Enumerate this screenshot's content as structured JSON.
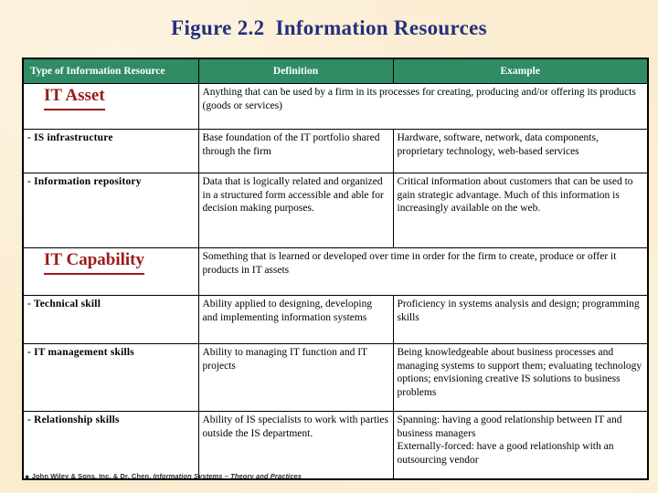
{
  "slide": {
    "title": "Figure 2.2  Information Resources",
    "background_color": "#faeccf",
    "title_color": "#262f7e",
    "header_color": "#2f8c65",
    "category_color": "#9b1b1b"
  },
  "table": {
    "headers": [
      "Type of Information Resource",
      "Definition",
      "Example"
    ],
    "rows": [
      {
        "kind": "category",
        "label": "IT Asset",
        "definition": "Anything that can be used by a firm in its processes for creating, producing and/or offering its products (goods or services)"
      },
      {
        "kind": "item",
        "label": "- IS infrastructure",
        "definition": "Base foundation of the IT portfolio shared through the firm",
        "example": "Hardware, software, network, data components, proprietary technology, web-based services"
      },
      {
        "kind": "item",
        "label": "- Information repository",
        "definition": "Data that is logically related and organized in a structured form accessible and able for decision making purposes.",
        "example": "Critical information about customers that can be used to gain strategic advantage.  Much of this information is increasingly available on the web."
      },
      {
        "kind": "category",
        "label": "IT Capability",
        "definition": "Something that is learned or developed over time in order for the firm to create, produce or offer it products in IT assets"
      },
      {
        "kind": "item",
        "label": "- Technical skill",
        "definition": "Ability applied to designing, developing and implementing information systems",
        "example": "Proficiency in systems analysis and design; programming skills"
      },
      {
        "kind": "item",
        "label": "- IT management skills",
        "definition": "Ability to managing IT function and IT projects",
        "example": "Being knowledgeable about business processes and managing systems to support them; evaluating technology options; envisioning creative IS solutions to business problems"
      },
      {
        "kind": "item",
        "label": "- Relationship skills",
        "definition": "Ability of IS specialists to work with parties outside the IS department.",
        "example": "Spanning: having a good relationship between IT and business managers\nExternally-forced: have a good relationship with an outsourcing vendor"
      }
    ]
  },
  "footer": {
    "mark": "●",
    "text_before": "John Wiley & Sons, Inc. & Dr. Chen, ",
    "text_italic": "Information Systems – Theory and Practices"
  }
}
